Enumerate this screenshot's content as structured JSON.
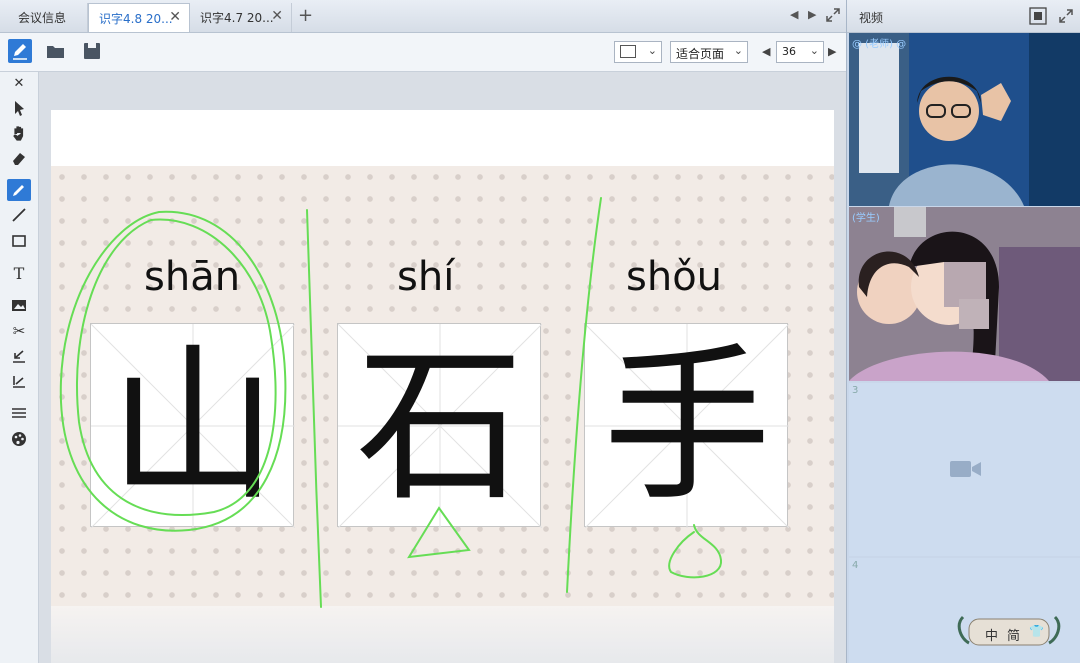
{
  "tabs": [
    {
      "label": "会议信息",
      "active": false,
      "closable": false
    },
    {
      "label": "识字4.8 20...",
      "active": true,
      "closable": true
    },
    {
      "label": "识字4.7 20...",
      "active": false,
      "closable": true
    }
  ],
  "tab_add": "+",
  "tab_close": "✕",
  "toolbar": {
    "fit_option": "适合页面",
    "font_size": "36"
  },
  "slide": {
    "characters": [
      {
        "pinyin": "shān",
        "hanzi": "山"
      },
      {
        "pinyin": "shí",
        "hanzi": "石"
      },
      {
        "pinyin": "shǒu",
        "hanzi": "手"
      }
    ]
  },
  "video_panel": {
    "title": "视频",
    "tiles": [
      {
        "label": "@ (老师) @"
      },
      {
        "label": "(学生)"
      },
      {
        "number": "3"
      },
      {
        "number": "4"
      }
    ]
  },
  "ime_bar": {
    "lang": "中",
    "mode": "简"
  },
  "colors": {
    "accent": "#2f7ad6",
    "annotation": "#66dd55",
    "slide_bg": "#f2ebe6"
  }
}
